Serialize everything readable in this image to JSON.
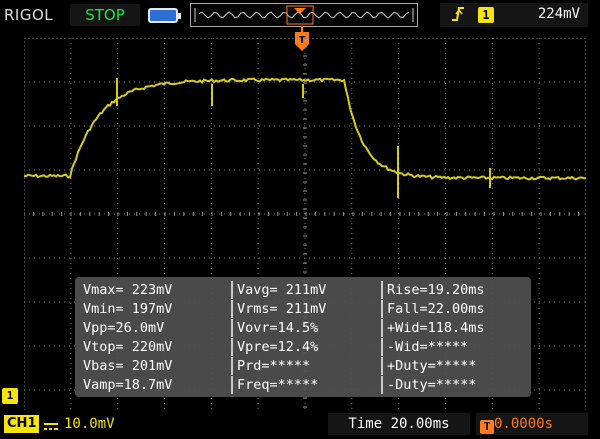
{
  "header": {
    "brand": "RIGOL",
    "run_state": "STOP",
    "trigger_source": "1",
    "trigger_level": "224mV"
  },
  "trigger_marker_label": "T",
  "ground_marker_label": "1",
  "colors": {
    "trace": "#d6cc1a",
    "accent_orange": "#ff7b1a",
    "run_green": "#19e64a",
    "channel_yellow": "#f6e40a"
  },
  "measurements": [
    [
      "Vmax= 223mV",
      "Vavg= 211mV",
      "Rise=19.20ms"
    ],
    [
      "Vmin= 197mV",
      "Vrms= 211mV",
      "Fall=22.00ms"
    ],
    [
      "Vpp=26.0mV",
      "Vovr=14.5%",
      "+Wid=118.4ms"
    ],
    [
      "Vtop= 220mV",
      "Vpre=12.4%",
      "-Wid=*****"
    ],
    [
      "Vbas= 201mV",
      "Prd=*****",
      "+Duty=*****"
    ],
    [
      "Vamp=18.7mV",
      "Freq=*****",
      "-Duty=*****"
    ]
  ],
  "footer": {
    "channel": "CH1",
    "scale": "10.0mV",
    "timebase": "Time 20.00ms",
    "trigger_offset": "0.0000s",
    "trigger_offset_icon": "T"
  },
  "icons": {
    "battery": "battery-icon",
    "edge": "rising-edge-icon",
    "coupling": "dc-coupling-icon"
  }
}
